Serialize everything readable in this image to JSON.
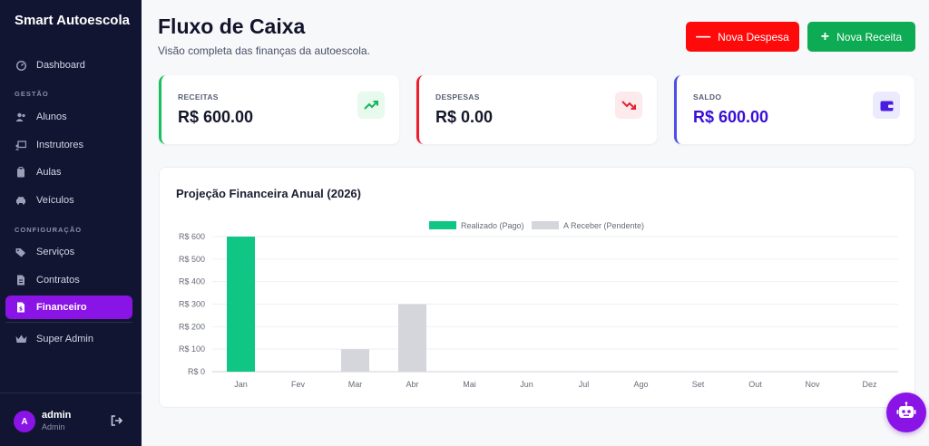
{
  "app": {
    "brand": "Smart Autoescola"
  },
  "sidebar": {
    "items": [
      {
        "label": "Dashboard",
        "icon": "gauge-icon"
      },
      {
        "section": "GESTÃO"
      },
      {
        "label": "Alunos",
        "icon": "users-icon"
      },
      {
        "label": "Instrutores",
        "icon": "chalkboard-icon"
      },
      {
        "label": "Aulas",
        "icon": "clipboard-icon"
      },
      {
        "label": "Veículos",
        "icon": "car-icon"
      },
      {
        "section": "CONFIGURAÇÃO"
      },
      {
        "label": "Serviços",
        "icon": "tags-icon"
      },
      {
        "label": "Contratos",
        "icon": "file-icon"
      },
      {
        "label": "Financeiro",
        "icon": "invoice-icon",
        "active": true
      },
      {
        "label": "Super Admin",
        "icon": "crown-icon"
      }
    ],
    "user": {
      "initial": "A",
      "name": "admin",
      "role": "Admin"
    }
  },
  "header": {
    "title": "Fluxo de Caixa",
    "subtitle": "Visão completa das finanças da autoescola.",
    "buttons": {
      "expense": "Nova Despesa",
      "income": "Nova Receita"
    }
  },
  "cards": [
    {
      "label": "RECEITAS",
      "value": "R$ 600.00",
      "color": "#16c05a",
      "icon": "trend-up-icon"
    },
    {
      "label": "DESPESAS",
      "value": "R$ 0.00",
      "color": "#ef1c2e",
      "icon": "trend-down-icon"
    },
    {
      "label": "SALDO",
      "value": "R$ 600.00",
      "color": "#4f4ee8",
      "value_color": "#3a0fd6",
      "icon": "wallet-icon"
    }
  ],
  "colors": {
    "sidebar_bg": "#111532",
    "accent": "#8a14e6",
    "paid": "#0fc684",
    "pending": "#d4d6dc"
  },
  "chart_data": {
    "type": "bar",
    "title": "Projeção Financeira Anual (2026)",
    "categories": [
      "Jan",
      "Fev",
      "Mar",
      "Abr",
      "Mai",
      "Jun",
      "Jul",
      "Ago",
      "Set",
      "Out",
      "Nov",
      "Dez"
    ],
    "series": [
      {
        "name": "Realizado (Pago)",
        "values": [
          600,
          0,
          0,
          0,
          0,
          0,
          0,
          0,
          0,
          0,
          0,
          0
        ],
        "color": "#0fc684"
      },
      {
        "name": "A Receber (Pendente)",
        "values": [
          0,
          0,
          100,
          300,
          0,
          0,
          0,
          0,
          0,
          0,
          0,
          0
        ],
        "color": "#d4d6dc"
      }
    ],
    "stacked": true,
    "ylim": [
      0,
      600
    ],
    "yticks": [
      "R$ 0",
      "R$ 100",
      "R$ 200",
      "R$ 300",
      "R$ 400",
      "R$ 500",
      "R$ 600"
    ],
    "legend": "top",
    "grid": true
  }
}
